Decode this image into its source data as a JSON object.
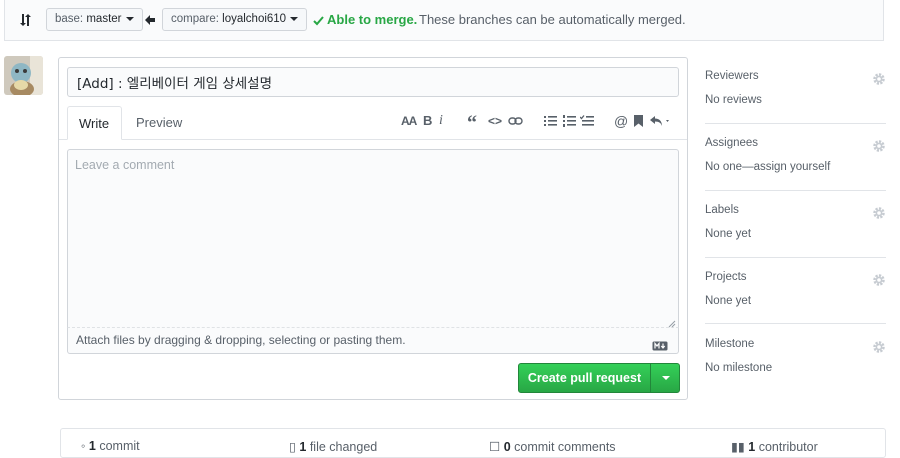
{
  "compare": {
    "base_prefix": "base:",
    "base_branch": "master",
    "compare_prefix": "compare:",
    "compare_branch": "loyalchoi610",
    "merge_status": "Able to merge.",
    "merge_message": "These branches can be automatically merged."
  },
  "form": {
    "title_value": "[Add] : 엘리베이터 게임 상세설명",
    "tabs": [
      {
        "label": "Write"
      },
      {
        "label": "Preview"
      }
    ],
    "comment_placeholder": "Leave a comment",
    "attach_text": "Attach files by dragging & dropping, selecting or pasting them.",
    "submit_label": "Create pull request"
  },
  "toolbar": {
    "header_glyph": "AA",
    "bold_glyph": "B",
    "italic_glyph": "i",
    "quote_glyph": "“",
    "code_glyph": "<>",
    "mention_glyph": "@"
  },
  "sidebar": {
    "sections": [
      {
        "heading": "Reviewers",
        "value": "No reviews"
      },
      {
        "heading": "Assignees",
        "value": "No one—assign yourself"
      },
      {
        "heading": "Labels",
        "value": "None yet"
      },
      {
        "heading": "Projects",
        "value": "None yet"
      },
      {
        "heading": "Milestone",
        "value": "No milestone"
      }
    ]
  },
  "summary": {
    "commits_count": "1",
    "commits_label": "commit",
    "files_count": "1",
    "files_label": "file changed",
    "comments_count": "0",
    "comments_label": "commit comments",
    "contributors_count": "1",
    "contributors_label": "contributor"
  },
  "colors": {
    "accent_green": "#28a745",
    "merge_green": "#28a745",
    "muted": "#586069"
  }
}
